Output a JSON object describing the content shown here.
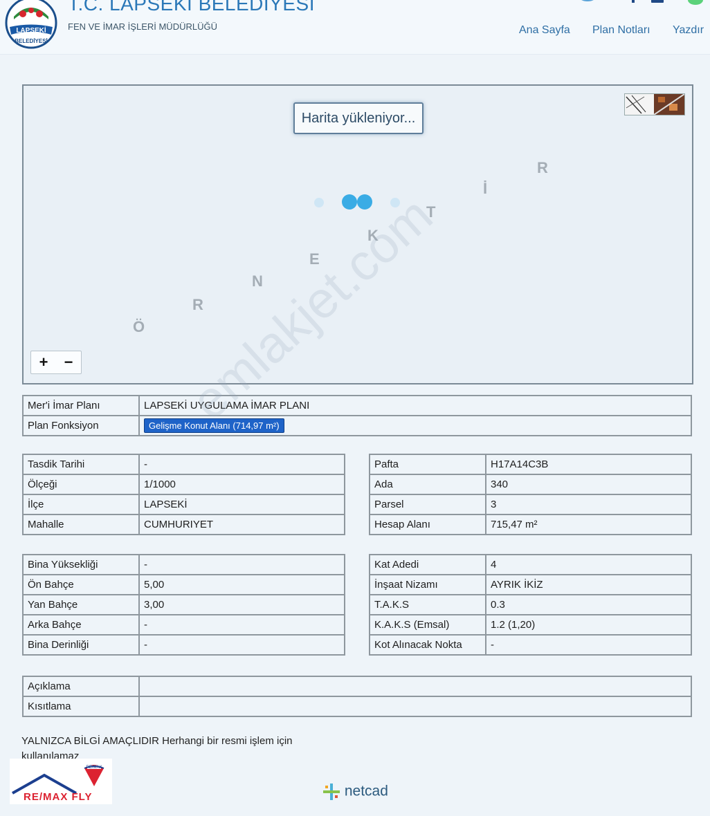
{
  "header": {
    "title": "T.C. LAPSEKİ BELEDİYESİ",
    "subtitle": "FEN VE İMAR İŞLERİ MÜDÜRLÜĞÜ",
    "logo_text_top": "LAPSEKİ",
    "logo_text_bottom": "BELEDİYESİ",
    "nav": [
      {
        "label": "Ana Sayfa"
      },
      {
        "label": "Plan Notları"
      },
      {
        "label": "Yazdır"
      }
    ]
  },
  "map": {
    "loading_text": "Harita yükleniyor...",
    "watermark_letters": [
      "Ö",
      "R",
      "N",
      "E",
      "K",
      "T",
      "İ",
      "R"
    ],
    "zoom_in": "+",
    "zoom_out": "−"
  },
  "plan": {
    "rows": [
      {
        "label": "Mer'i İmar Planı",
        "value": "LAPSEKİ UYGULAMA İMAR PLANI"
      },
      {
        "label": "Plan Fonksiyon",
        "value": "Gelişme Konut Alanı (714,97 m²)"
      }
    ]
  },
  "info_left_1": [
    {
      "label": "Tasdik Tarihi",
      "value": "-"
    },
    {
      "label": "Ölçeği",
      "value": "1/1000"
    },
    {
      "label": "İlçe",
      "value": "LAPSEKİ"
    },
    {
      "label": "Mahalle",
      "value": "CUMHURIYET"
    }
  ],
  "info_right_1": [
    {
      "label": "Pafta",
      "value": "H17A14C3B"
    },
    {
      "label": "Ada",
      "value": "340"
    },
    {
      "label": "Parsel",
      "value": "3"
    },
    {
      "label": "Hesap Alanı",
      "value": "715,47 m²"
    }
  ],
  "info_left_2": [
    {
      "label": "Bina Yüksekliği",
      "value": "-"
    },
    {
      "label": "Ön Bahçe",
      "value": "5,00"
    },
    {
      "label": "Yan Bahçe",
      "value": "3,00"
    },
    {
      "label": "Arka Bahçe",
      "value": "-"
    },
    {
      "label": "Bina Derinliği",
      "value": "-"
    }
  ],
  "info_right_2": [
    {
      "label": "Kat Adedi",
      "value": "4"
    },
    {
      "label": "İnşaat Nizamı",
      "value": "AYRIK İKİZ"
    },
    {
      "label": "T.A.K.S",
      "value": "0.3"
    },
    {
      "label": "K.A.K.S (Emsal)",
      "value": "1.2 (1,20)"
    },
    {
      "label": "Kot Alınacak Nokta",
      "value": "-"
    }
  ],
  "notes": [
    {
      "label": "Açıklama",
      "value": ""
    },
    {
      "label": "Kısıtlama",
      "value": ""
    }
  ],
  "disclaimer": "YALNIZCA BİLGİ AMAÇLIDIR Herhangi bir resmi işlem için kullanılamaz",
  "watermark_text": "emlakjet.com",
  "remax": {
    "brand": "RE/MAX FLY",
    "badge": "RE/MAX"
  },
  "footer": {
    "brand": "netcad"
  },
  "colors": {
    "accent": "#2b78b8",
    "badge": "#1e63c8",
    "spinner": "#3aace5"
  }
}
